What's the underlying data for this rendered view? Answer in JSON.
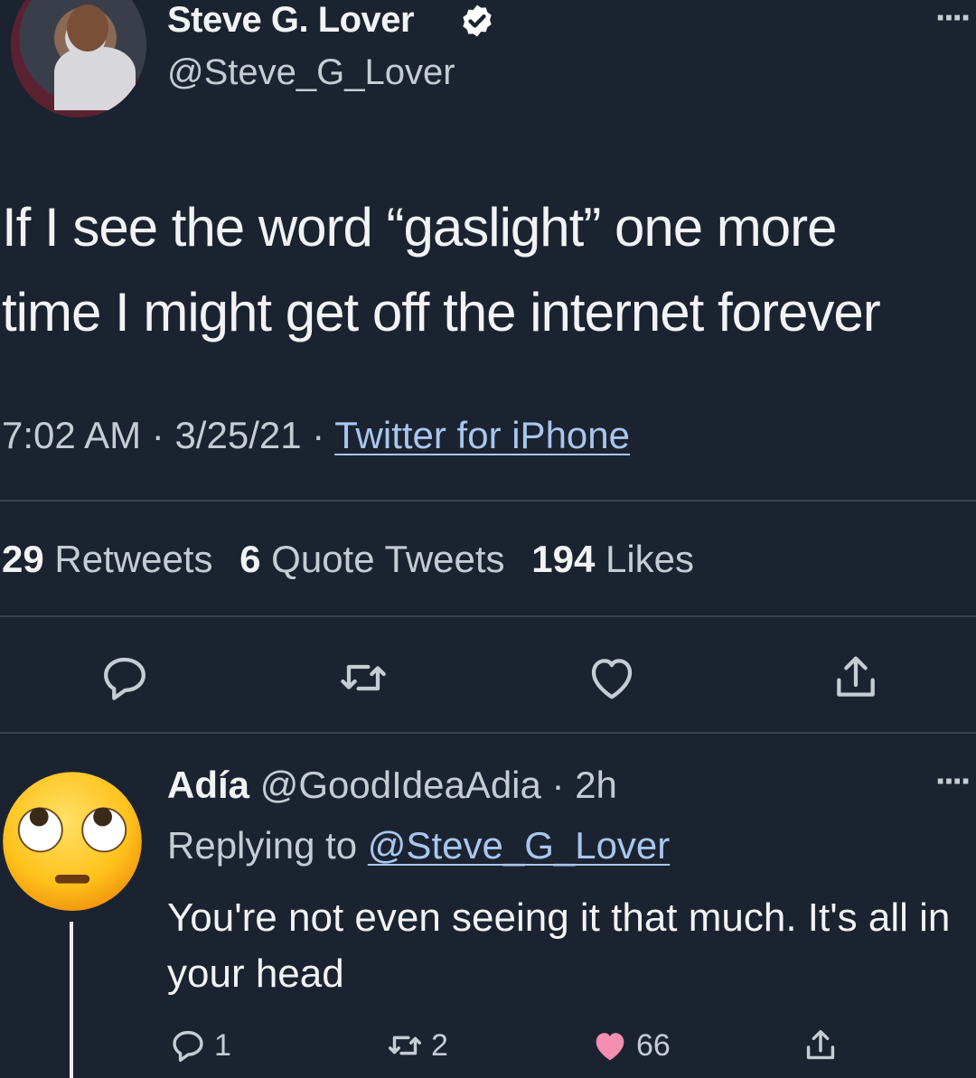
{
  "tweet": {
    "display_name": "Steve G. Lover",
    "handle": "@Steve_G_Lover",
    "text": "If I see the word “gaslight” one more\ntime I might get off the internet forever",
    "time": "7:02 AM",
    "date": "3/25/21",
    "separator": "·",
    "source": "Twitter for iPhone",
    "stats": {
      "retweets_count": "29",
      "retweets_label": "Retweets",
      "quotes_count": "6",
      "quotes_label": "Quote Tweets",
      "likes_count": "194",
      "likes_label": "Likes"
    },
    "more_glyph": "····"
  },
  "reply": {
    "display_name": "Adía",
    "handle": "@GoodIdeaAdia",
    "age": "· 2h",
    "replying_prefix": "Replying to",
    "replying_to": "@Steve_G_Lover",
    "text": "You're not even seeing it that much. It's all in your head",
    "reply_count": "1",
    "retweet_count": "2",
    "like_count": "66",
    "more_glyph": "····"
  },
  "colors": {
    "background": "#1c2330",
    "text": "#f1f3f5",
    "muted": "#c6ccd4",
    "link": "#a8c7ef",
    "liked": "#f48fb1"
  },
  "icons": {
    "verified": "verified-badge-icon",
    "reply": "speech-bubble-icon",
    "retweet": "retweet-arrows-icon",
    "like": "heart-icon",
    "share": "share-arrow-icon"
  }
}
